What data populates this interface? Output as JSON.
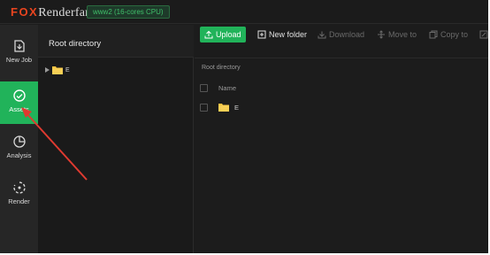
{
  "app": {
    "logo_fox": "FOX",
    "logo_rest": "Renderfarm",
    "server_badge": "www2 (16-cores CPU)"
  },
  "sidebar": {
    "items": [
      {
        "label": "New Job",
        "icon": "new-job-icon"
      },
      {
        "label": "Assets",
        "icon": "assets-icon",
        "active": true
      },
      {
        "label": "Analysis",
        "icon": "analysis-icon"
      },
      {
        "label": "Render",
        "icon": "render-icon"
      }
    ]
  },
  "tree": {
    "title": "Root directory",
    "nodes": [
      {
        "label": "E"
      }
    ]
  },
  "toolbar": {
    "upload": "Upload",
    "new_folder": "New folder",
    "download": "Download",
    "move_to": "Move to",
    "copy_to": "Copy to"
  },
  "main": {
    "breadcrumb": "Root directory",
    "column_name": "Name",
    "rows": [
      {
        "name": "E"
      }
    ]
  },
  "colors": {
    "accent": "#21b35a",
    "logo_red": "#e8441f",
    "arrow": "#e03a30"
  }
}
